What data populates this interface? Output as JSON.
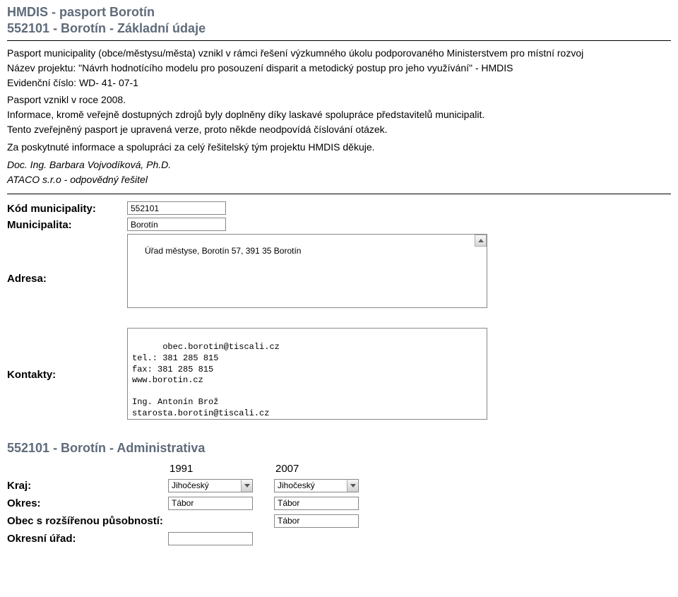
{
  "header": {
    "title": "HMDIS - pasport Borotín",
    "subtitle": "552101 - Borotín - Základní údaje"
  },
  "intro": {
    "p1": "Pasport municipality (obce/městysu/města) vznikl v rámci řešení výzkumného úkolu podporovaného Ministerstvem pro místní rozvoj",
    "p2": "Název projektu: \"Návrh hodnotícího modelu pro posouzení disparit a metodický postup pro jeho využívání\" - HMDIS",
    "p3": "Evidenční číslo: WD- 41- 07-1",
    "p4": "Pasport vznikl v roce 2008.",
    "p5": "Informace, kromě veřejně dostupných zdrojů byly doplněny díky laskavé spolupráce představitelů municipalit.",
    "p6": "Tento zveřejněný pasport je upravená verze, proto někde neodpovídá číslování otázek.",
    "p7": "Za poskytnuté informace a spolupráci za celý řešitelský tým projektu HMDIS děkuje.",
    "p8": "Doc. Ing. Barbara Vojvodíková, Ph.D.",
    "p9": "ATACO s.r.o - odpovědný řešitel"
  },
  "form": {
    "kod_label": "Kód municipality:",
    "kod_value": "552101",
    "muni_label": "Municipalita:",
    "muni_value": "Borotín",
    "adresa_label": "Adresa:",
    "adresa_value": "Úřad městyse, Borotín 57, 391 35 Borotín",
    "kontakty_label": "Kontakty:",
    "kontakty_value": "obec.borotin@tiscali.cz\ntel.: 381 285 815\nfax: 381 285 815\nwww.borotin.cz\n\nIng. Antonín Brož\nstarosta.borotin@tiscali.cz"
  },
  "admin": {
    "section_title": "552101 - Borotín - Administrativa",
    "year1": "1991",
    "year2": "2007",
    "kraj_label": "Kraj:",
    "kraj_1991": "Jihočeský",
    "kraj_2007": "Jihočeský",
    "okres_label": "Okres:",
    "okres_1991": "Tábor",
    "okres_2007": "Tábor",
    "orp_label": "Obec s rozšířenou působností:",
    "orp_1991": "",
    "orp_2007": "Tábor",
    "okurad_label": "Okresní úřad:",
    "okurad_1991": "",
    "okurad_2007": ""
  }
}
